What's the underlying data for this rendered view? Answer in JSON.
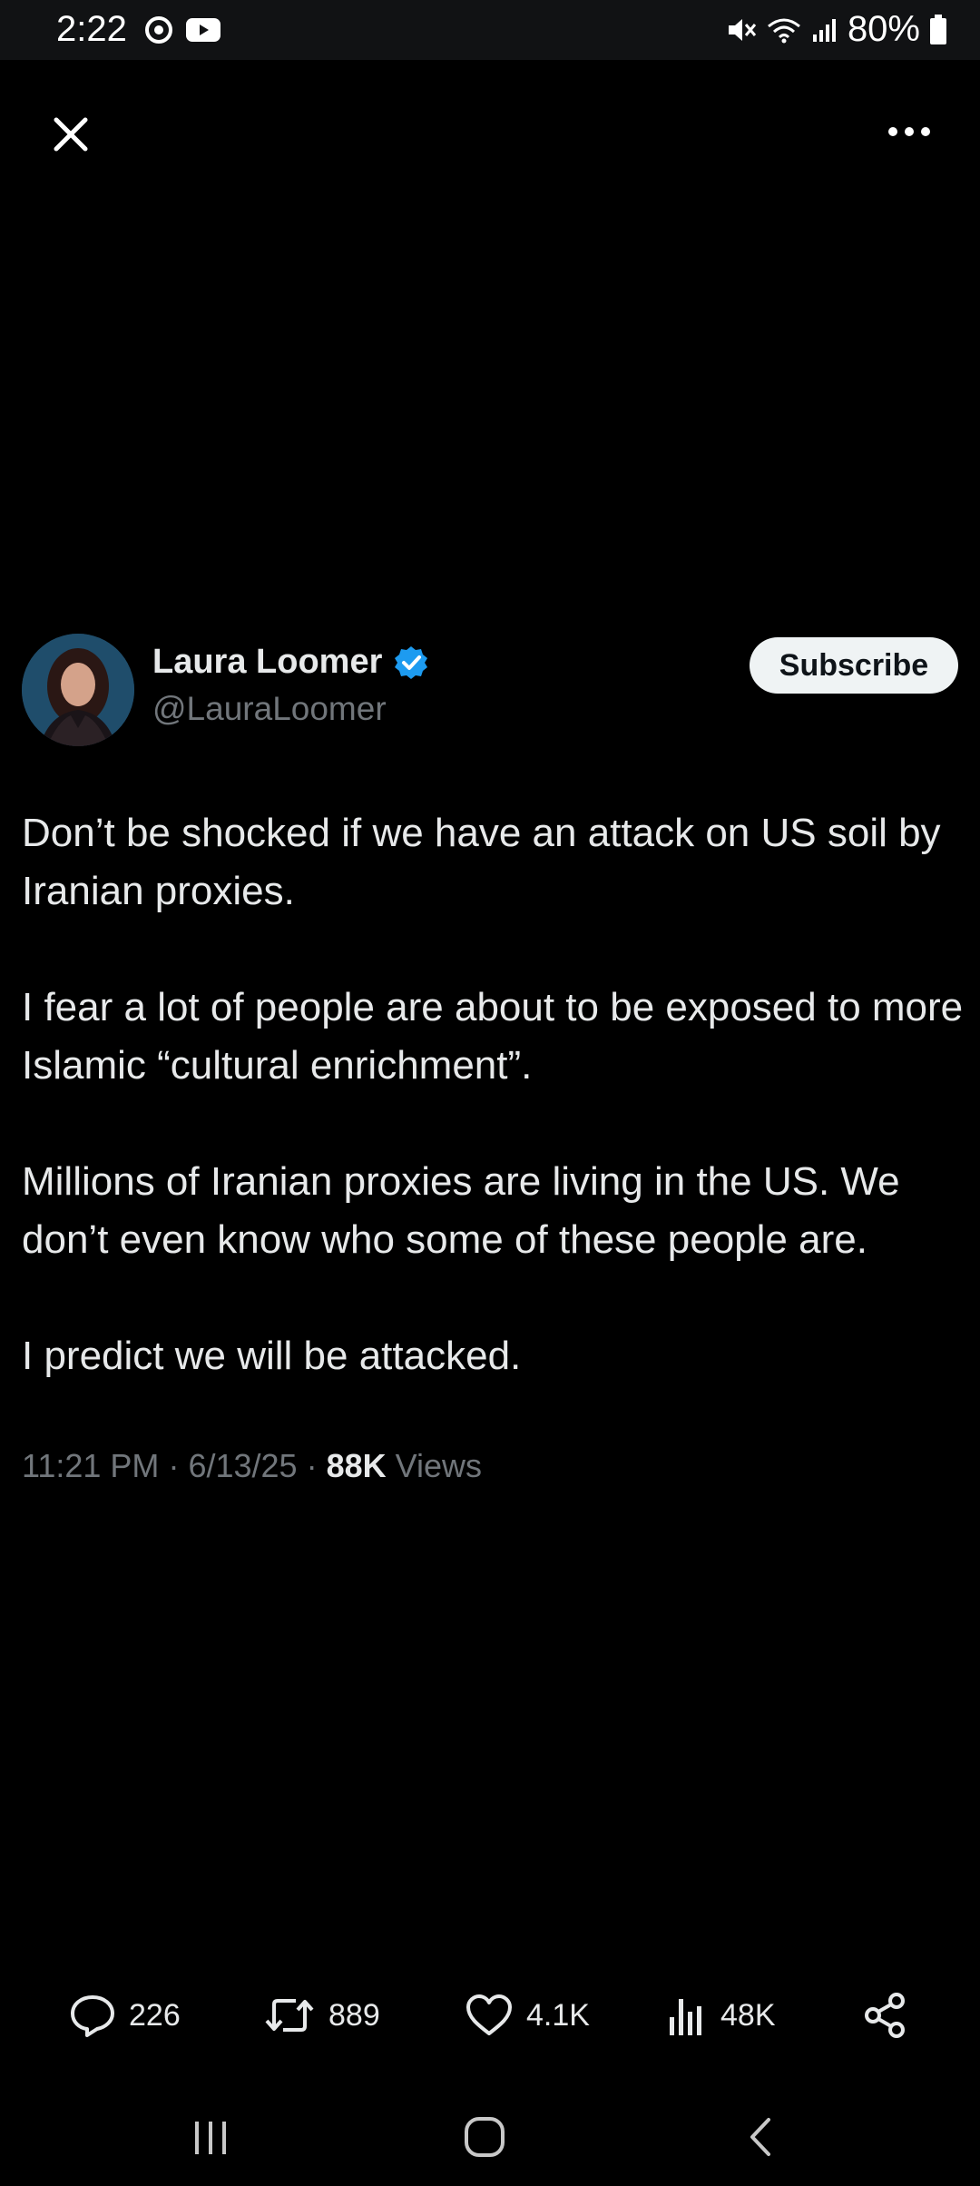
{
  "status_bar": {
    "time": "2:22",
    "battery": "80%"
  },
  "author": {
    "name": "Laura Loomer",
    "handle": "@LauraLoomer",
    "subscribe_label": "Subscribe",
    "verified_color": "#1d9bf0"
  },
  "post": {
    "paragraphs": [
      "Don’t be shocked if we have an attack on US soil by Iranian proxies.",
      "I fear a lot of people are about to be exposed to more Islamic “cultural enrichment”.",
      "Millions of Iranian proxies are living in the US. We don’t even know who some of these people are.",
      "I predict we will be attacked."
    ],
    "time": "11:21 PM",
    "date": "6/13/25",
    "views_count": "88K",
    "views_label": "Views"
  },
  "actions": {
    "replies": "226",
    "reposts": "889",
    "likes": "4.1K",
    "views": "48K"
  },
  "icons": {
    "close": "close-icon",
    "more": "more-icon",
    "reply": "reply-icon",
    "repost": "repost-icon",
    "like": "heart-icon",
    "views": "analytics-icon",
    "share": "share-icon"
  }
}
